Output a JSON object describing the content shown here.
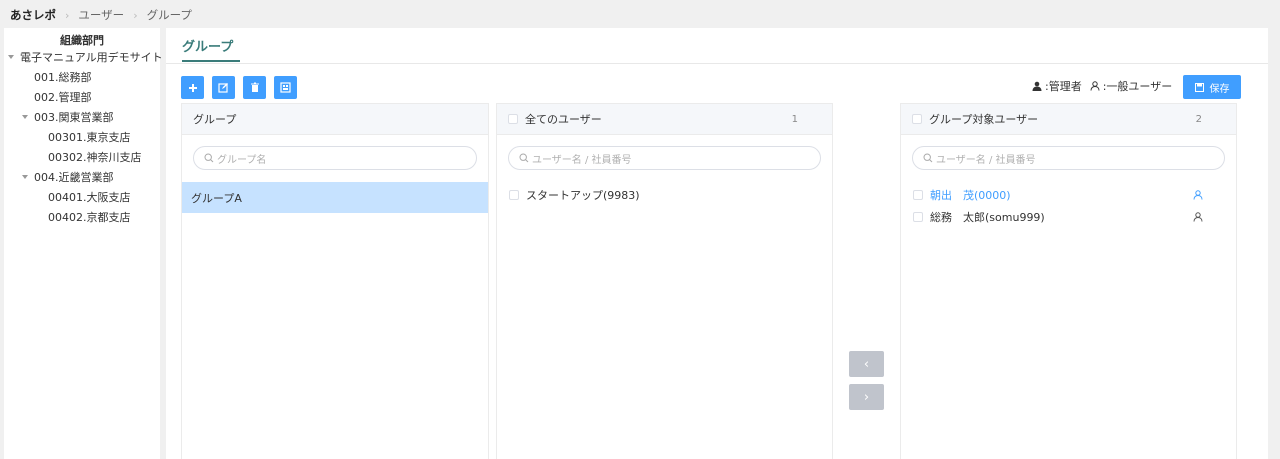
{
  "breadcrumb": [
    "あさレポ",
    "ユーザー",
    "グループ"
  ],
  "sidebar": {
    "title": "組織部門",
    "items": [
      {
        "label": "電子マニュアル用デモサイト",
        "expanded": true
      },
      {
        "label": "001.総務部"
      },
      {
        "label": "002.管理部"
      },
      {
        "label": "003.関東営業部",
        "expanded": true
      },
      {
        "label": "00301.東京支店"
      },
      {
        "label": "00302.神奈川支店"
      },
      {
        "label": "004.近畿営業部",
        "expanded": true
      },
      {
        "label": "00401.大阪支店"
      },
      {
        "label": "00402.京都支店"
      }
    ]
  },
  "tab": {
    "label": "グループ"
  },
  "toolbar": {
    "icons": [
      "plus-icon",
      "edit-icon",
      "trash-icon",
      "qr-icon"
    ]
  },
  "legend": {
    "admin": ":管理者",
    "user": ":一般ユーザー"
  },
  "save_label": "保存",
  "group_panel": {
    "header": "グループ",
    "search_placeholder": "グループ名",
    "items": [
      {
        "label": "グループA",
        "selected": true
      }
    ]
  },
  "all_users_panel": {
    "header": "全てのユーザー",
    "count": "1",
    "search_placeholder": "ユーザー名 / 社員番号",
    "items": [
      {
        "label": "スタートアップ(9983)"
      }
    ]
  },
  "target_users_panel": {
    "header": "グループ対象ユーザー",
    "count": "2",
    "search_placeholder": "ユーザー名 / 社員番号",
    "items": [
      {
        "label": "朝出　茂(0000)",
        "role": "admin",
        "color": "#409eff"
      },
      {
        "label": "総務　太郎(somu999)",
        "role": "user",
        "color": "#333333"
      }
    ]
  },
  "transfer": {
    "left": "‹",
    "right": "›"
  },
  "colors": {
    "accent": "#409eff",
    "tab": "#3a7c7a",
    "selected_row": "#c6e2ff",
    "disabled": "#c0c4cc"
  }
}
